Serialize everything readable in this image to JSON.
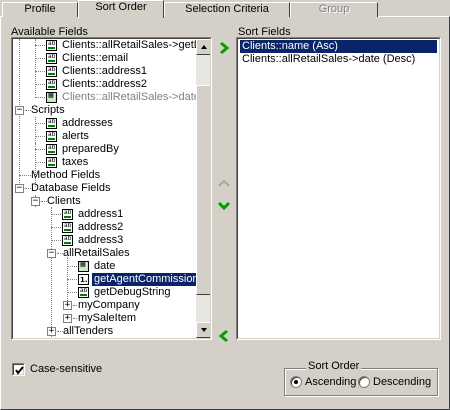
{
  "tabs": {
    "profile": "Profile",
    "sort_order": "Sort Order",
    "selection_criteria": "Selection Criteria",
    "group": "Group"
  },
  "available_fields": {
    "label": "Available Fields",
    "items": [
      {
        "text": "Clients::allRetailSales->getDe",
        "type": "field"
      },
      {
        "text": "Clients::email",
        "type": "field"
      },
      {
        "text": "Clients::address1",
        "type": "field"
      },
      {
        "text": "Clients::address2",
        "type": "field"
      },
      {
        "text": "Clients::allRetailSales->date",
        "type": "date"
      },
      {
        "text": "Scripts",
        "type": "folder"
      },
      {
        "text": "addresses",
        "type": "field"
      },
      {
        "text": "alerts",
        "type": "field"
      },
      {
        "text": "preparedBy",
        "type": "field"
      },
      {
        "text": "taxes",
        "type": "field"
      },
      {
        "text": "Method Fields",
        "type": "folder"
      },
      {
        "text": "Database Fields",
        "type": "folder"
      },
      {
        "text": "Clients",
        "type": "folder"
      },
      {
        "text": "address1",
        "type": "field"
      },
      {
        "text": "address2",
        "type": "field"
      },
      {
        "text": "address3",
        "type": "field"
      },
      {
        "text": "allRetailSales",
        "type": "folder"
      },
      {
        "text": "date",
        "type": "date"
      },
      {
        "text": "getAgentCommission",
        "type": "num"
      },
      {
        "text": "getDebugString",
        "type": "field"
      },
      {
        "text": "myCompany",
        "type": "folder"
      },
      {
        "text": "mySaleItem",
        "type": "folder"
      },
      {
        "text": "allTenders",
        "type": "folder"
      }
    ]
  },
  "sort_fields": {
    "label": "Sort Fields",
    "items": [
      "Clients::name (Asc)",
      "Clients::allRetailSales->date (Desc)"
    ]
  },
  "case_sensitive": {
    "label": "Case-sensitive",
    "checked": true
  },
  "sort_order": {
    "title": "Sort Order",
    "ascending": "Ascending",
    "descending": "Descending",
    "selected": "Ascending"
  },
  "colors": {
    "selection": "#0a246a",
    "arrow_green": "#00a000"
  }
}
